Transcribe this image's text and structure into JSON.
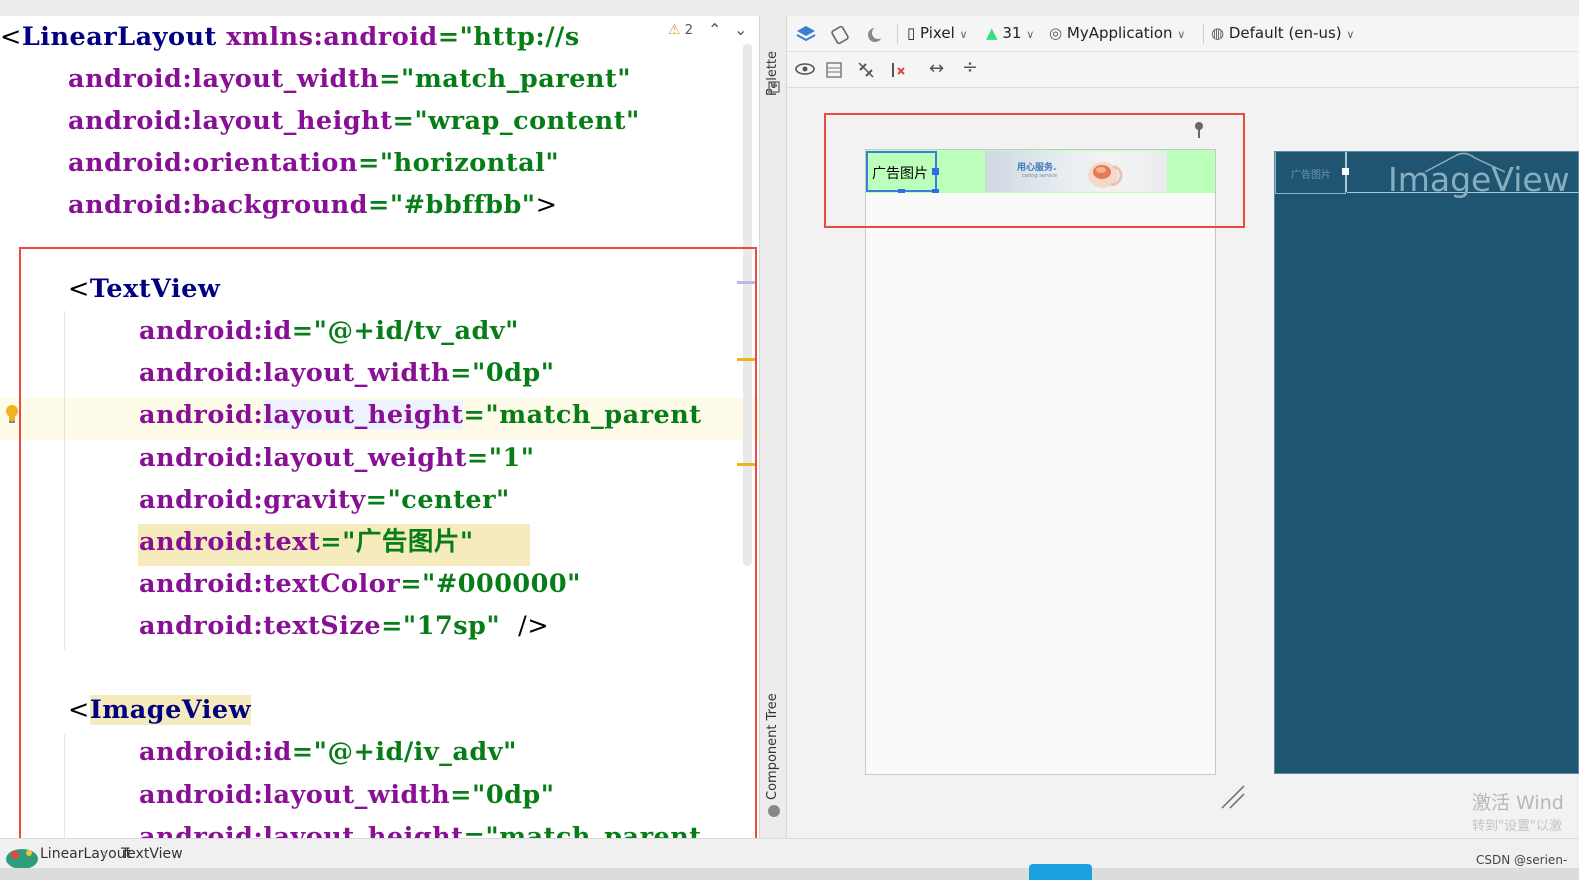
{
  "editor": {
    "warning_count": "2",
    "lines": [
      [
        {
          "t": "<",
          "c": "punct"
        },
        {
          "t": "LinearLayout ",
          "c": "tag"
        },
        {
          "t": "xmlns:android",
          "c": "attr"
        },
        {
          "t": "=\"http://s",
          "c": "val"
        }
      ],
      [
        {
          "t": "android:layout_width",
          "c": "attr"
        },
        {
          "t": "=\"match_parent\"",
          "c": "val"
        }
      ],
      [
        {
          "t": "android:layout_height",
          "c": "attr"
        },
        {
          "t": "=\"wrap_content\"",
          "c": "val"
        }
      ],
      [
        {
          "t": "android:orientation",
          "c": "attr"
        },
        {
          "t": "=\"horizontal\"",
          "c": "val"
        }
      ],
      [
        {
          "t": "android:background",
          "c": "attr"
        },
        {
          "t": "=\"#bbffbb\"",
          "c": "val"
        },
        {
          "t": ">",
          "c": "punct"
        }
      ],
      [],
      [
        {
          "t": "<",
          "c": "punct"
        },
        {
          "t": "TextView",
          "c": "tag"
        }
      ],
      [
        {
          "t": "android:id",
          "c": "attr"
        },
        {
          "t": "=\"@+id/tv_adv\"",
          "c": "val"
        }
      ],
      [
        {
          "t": "android:layout_width",
          "c": "attr"
        },
        {
          "t": "=\"0dp\"",
          "c": "val"
        }
      ],
      [
        {
          "t": "android:",
          "c": "attr"
        },
        {
          "t": "layout_height",
          "c": "attr hl-attr"
        },
        {
          "t": "=\"match_parent",
          "c": "val"
        }
      ],
      [
        {
          "t": "android:layout_weight",
          "c": "attr"
        },
        {
          "t": "=\"1\"",
          "c": "val"
        }
      ],
      [
        {
          "t": "android:gravity",
          "c": "attr"
        },
        {
          "t": "=\"center\"",
          "c": "val"
        }
      ],
      [
        {
          "t": "android:text",
          "c": "attr"
        },
        {
          "t": "=\"广告图片\"",
          "c": "val"
        }
      ],
      [
        {
          "t": "android:textColor",
          "c": "attr"
        },
        {
          "t": "=\"#000000\"",
          "c": "val"
        }
      ],
      [
        {
          "t": "android:textSize",
          "c": "attr"
        },
        {
          "t": "=\"17sp\" ",
          "c": "val"
        },
        {
          "t": " />",
          "c": "punct"
        }
      ],
      [],
      [
        {
          "t": "<",
          "c": "punct"
        },
        {
          "t": "ImageView",
          "c": "tag hl-tag"
        }
      ],
      [
        {
          "t": "android:id",
          "c": "attr"
        },
        {
          "t": "=\"@+id/iv_adv\"",
          "c": "val"
        }
      ],
      [
        {
          "t": "android:layout_width",
          "c": "attr"
        },
        {
          "t": "=\"0dp\"",
          "c": "val"
        }
      ],
      [
        {
          "t": "android:layout_height",
          "c": "attr"
        },
        {
          "t": "=\"match_parent",
          "c": "val"
        }
      ]
    ]
  },
  "side_strip": {
    "palette": "Palette",
    "component_tree": "Component Tree"
  },
  "toolbar": {
    "device": "Pixel",
    "api_level": "31",
    "theme": "MyApplication",
    "locale": "Default (en-us)"
  },
  "design": {
    "textview_text": "广告图片",
    "ad_title": "用心服务.",
    "ad_subtitle": "caring service",
    "background_color": "#bbffbb",
    "blueprint_textview": "广告图片",
    "blueprint_imageview": "ImageView"
  },
  "watermark": {
    "line1": "激活 Wind",
    "line2": "转到\"设置\"以激"
  },
  "breadcrumb": {
    "item1": "LinearLayout",
    "item2": "TextView"
  },
  "credit": "CSDN @serien-"
}
